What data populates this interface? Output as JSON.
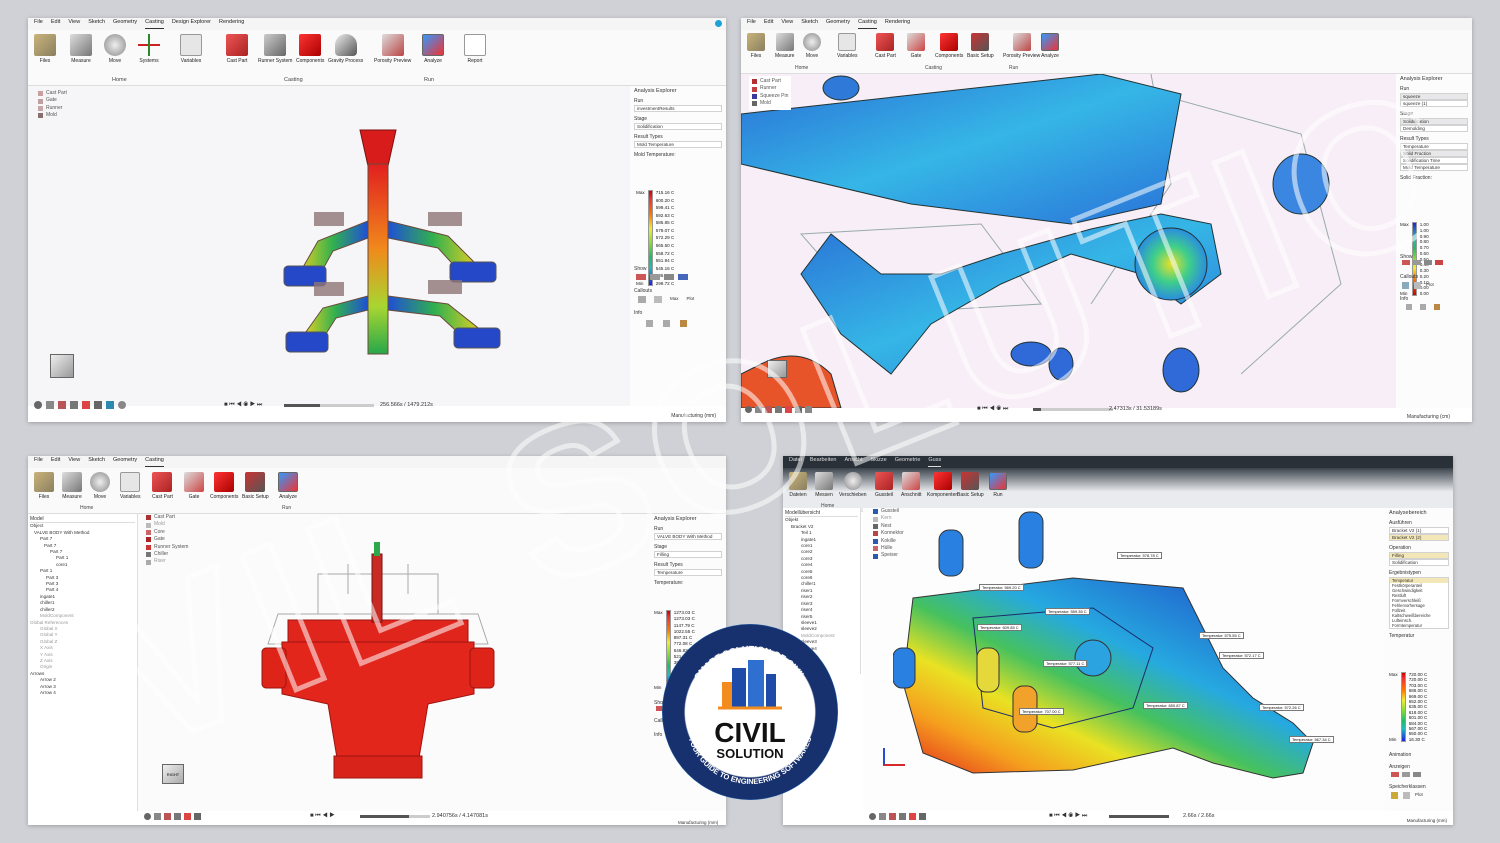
{
  "colors": {
    "accent": "#2196f3",
    "hot": "#e53935",
    "cold": "#1e40c8"
  },
  "watermark": {
    "text": "CIVIL SOLUTION"
  },
  "logo": {
    "top": "SMART SOLUTION OF CIVIL",
    "line1": "CIVIL",
    "line2": "SOLUTION",
    "bottom": "YOUR GUIDE TO ENGINEERING SOFTWARES"
  },
  "p1": {
    "menu": [
      "File",
      "Edit",
      "View",
      "Sketch",
      "Geometry",
      "Casting",
      "Design Explorer",
      "Rendering"
    ],
    "ribbon": [
      "Files",
      "Measure",
      "Move",
      "Systems",
      "Variables",
      "Cast Part",
      "Runner System",
      "Components",
      "Gravity Process",
      "Porosity Preview",
      "Analyze",
      "Report"
    ],
    "groups": {
      "home": "Home",
      "casting": "Casting",
      "run": "Run"
    },
    "materials": [
      "Cast Part",
      "Gate",
      "Runner",
      "Mold"
    ],
    "explorer": {
      "title": "Analysis Explorer",
      "run_label": "Run",
      "run_value": "investmentResults",
      "stage_label": "Stage",
      "stage_value": "Solidification",
      "rt_label": "Result Types",
      "rt_value": "Mold Temperature",
      "legend_title": "Mold Temperature:",
      "max_label": "Max",
      "min_label": "Min",
      "values": [
        "715.16 C",
        "600.20 C",
        "599.41 C",
        "592.63 C",
        "585.85 C",
        "579.07 C",
        "572.29 C",
        "565.50 C",
        "558.72 C",
        "551.94 C",
        "545.16 C",
        "536.36 C",
        "299.72 C"
      ],
      "show": "Show",
      "callouts": "Callouts",
      "info": "Info",
      "max_short": "Max",
      "min_short": "Min",
      "plot": "Plot"
    },
    "time": "256.566s / 1479.212s",
    "units": "Manufacturing (mm)"
  },
  "p2": {
    "menu": [
      "File",
      "Edit",
      "View",
      "Sketch",
      "Geometry",
      "Casting",
      "Rendering"
    ],
    "ribbon": [
      "Files",
      "Measure",
      "Move",
      "Variables",
      "Cast Part",
      "Gate",
      "Components",
      "Basic Setup",
      "Porosity Preview",
      "Analyze"
    ],
    "groups": {
      "home": "Home",
      "casting": "Casting",
      "run": "Run"
    },
    "materials": [
      "Cast Part",
      "Runner",
      "Squeeze Pin",
      "Mold"
    ],
    "explorer": {
      "title": "Analysis Explorer",
      "run_label": "Run",
      "run_items": [
        "squeeze",
        "squeeze (1)"
      ],
      "stage_label": "Stage",
      "stage_items": [
        "Solidification",
        "Demolding"
      ],
      "rt_label": "Result Types",
      "rt_items": [
        "Temperature",
        "Solid Fraction",
        "Solidification Time",
        "Mold Temperature"
      ],
      "legend_title": "Solid Fraction:",
      "max_label": "Max",
      "min_label": "Min",
      "values": [
        "1.00",
        "1.00",
        "0.90",
        "0.80",
        "0.70",
        "0.60",
        "0.50",
        "0.40",
        "0.30",
        "0.20",
        "0.10",
        "0.00",
        "0.00"
      ],
      "show": "Show",
      "callouts": "Callouts",
      "info": "Info",
      "plot": "Plot"
    },
    "time": "2.47313s / 31.53189s",
    "units": "Manufacturing (cm)"
  },
  "p3": {
    "menu": [
      "File",
      "Edit",
      "View",
      "Sketch",
      "Geometry",
      "Casting"
    ],
    "ribbon": [
      "Files",
      "Measure",
      "Move",
      "Variables",
      "Cast Part",
      "Gate",
      "Components",
      "Basic Setup",
      "Analyze"
    ],
    "groups": {
      "home": "Home",
      "run": "Run"
    },
    "tree_header": "Model",
    "tree": [
      "Object",
      "VALVE BODY With Method",
      "Part 7",
      "Part 7",
      "Part 7",
      "Part 1",
      "core1",
      "Part 1",
      "Part 3",
      "Part 3",
      "Part 4",
      "ingate1",
      "chiller1",
      "chiller2",
      "MoldComponent",
      "Global References",
      "Global X",
      "Global Y",
      "Global Z",
      "X Axis",
      "Y Axis",
      "Z Axis",
      "Origin",
      "Arrows",
      "Arrow 2",
      "Arrow 3",
      "Arrow 4"
    ],
    "materials": [
      "Cast Part",
      "Mold",
      "Core",
      "Gate",
      "Runner System",
      "Chiller",
      "Riser"
    ],
    "explorer": {
      "title": "Analysis Explorer",
      "run_label": "Run",
      "run_value": "VALVE BODY With Method",
      "stage_label": "Stage",
      "stage_value": "Filling",
      "rt_label": "Result Types",
      "rt_value": "Temperature",
      "legend_title": "Temperature:",
      "max_label": "Max",
      "min_label": "Min",
      "values": [
        "1273.03 C",
        "1273.03 C",
        "1147.79 C",
        "1022.55 C",
        "897.31 C",
        "772.08 C",
        "646.82 C",
        "521.58 C",
        "396.34 C",
        "271.10 C",
        "145.85 C",
        "20.61 C",
        "20.00 C"
      ],
      "show": "Show",
      "callouts": "Callouts",
      "info": "Info"
    },
    "view_cube": "RIGHT",
    "time": "2.940756s / 4.147081s",
    "units": "Manufacturing (mm)"
  },
  "p4": {
    "menu": [
      "Datei",
      "Bearbeiten",
      "Ansicht",
      "Skizze",
      "Geometrie",
      "Guss"
    ],
    "ribbon": [
      "Dateien",
      "Messen",
      "Verschieben",
      "Gussteil",
      "Anschnitt",
      "Komponenten",
      "Basic Setup",
      "Run"
    ],
    "groups": {
      "home": "Home"
    },
    "tree_header": "Modellübersicht",
    "tree": [
      "Objekt",
      "Bracket V2",
      "Teil 1",
      "ingate1",
      "core1",
      "core2",
      "core3",
      "core4",
      "core5",
      "core6",
      "chiller1",
      "riser1",
      "riser2",
      "riser3",
      "riser4",
      "riser5",
      "sleeve1",
      "sleeve2",
      "MoldComponent",
      "sleeve3",
      "sleeve4",
      "riser6"
    ],
    "materials": [
      "Gussteil",
      "Kern",
      "Nest",
      "Konnektor",
      "Kokille",
      "Hülle",
      "Speiser"
    ],
    "explorer": {
      "title": "Analysebereich",
      "run_label": "Ausführen",
      "run_items": [
        "Bracket V2 (1)",
        "Bracket V2 (2)"
      ],
      "stage_label": "Operation",
      "stage_items": [
        "Filling",
        "Solidification"
      ],
      "rt_label": "Ergebnistypen",
      "rt_items": [
        "Temperatur",
        "Festkörperanteil",
        "Geschwindigkeit",
        "Restluft",
        "Formverschleiß",
        "Fehlervorhersage",
        "Füllzeit",
        "Kaltschweißbereiche",
        "Lufteinsch.",
        "Formtemperatur"
      ],
      "legend_title": "Temperatur",
      "max_label": "Max",
      "min_label": "Min",
      "values": [
        "720.00 C",
        "720.00 C",
        "703.00 C",
        "686.00 C",
        "669.00 C",
        "652.00 C",
        "635.00 C",
        "618.00 C",
        "601.00 C",
        "584.00 C",
        "567.00 C",
        "550.00 C",
        "16.30 C"
      ],
      "animation": "Animation",
      "anzeigen": "Anzeigen",
      "speicher": "Speicherklassen",
      "plot": "Plot"
    },
    "callouts": [
      "Temperatur: 578.78 C",
      "Temperatur: 569.20 C",
      "Temperatur: 559.35 C",
      "Temperatur: 609.85 C",
      "Temperatur: 577.11 C",
      "Temperatur: 575.55 C",
      "Temperatur: 572.17 C",
      "Temperatur: 707.00 C",
      "Temperatur: 650.87 C",
      "Temperatur: 572.26 C",
      "Temperatur: 567.34 C"
    ],
    "time": "2.66s / 2.66s",
    "units": "Manufacturing (mm)"
  }
}
